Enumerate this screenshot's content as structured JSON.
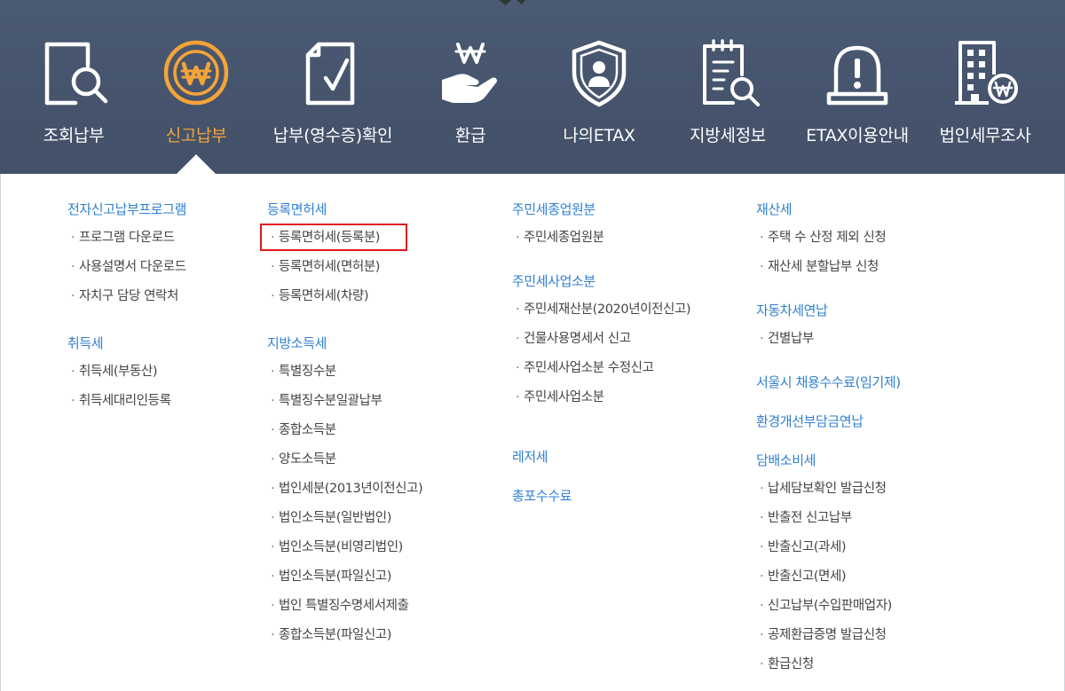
{
  "nav": [
    {
      "label": "조회납부",
      "icon": "search-document-icon"
    },
    {
      "label": "신고납부",
      "icon": "won-coin-icon",
      "active": true
    },
    {
      "label": "납부(영수증)확인",
      "icon": "document-check-icon"
    },
    {
      "label": "환급",
      "icon": "won-hand-icon"
    },
    {
      "label": "나의ETAX",
      "icon": "user-shield-icon"
    },
    {
      "label": "지방세정보",
      "icon": "notepad-search-icon"
    },
    {
      "label": "ETAX이용안내",
      "icon": "alert-bell-icon"
    },
    {
      "label": "법인세무조사",
      "icon": "building-won-icon"
    }
  ],
  "menu": {
    "col1": [
      {
        "title": "전자신고납부프로그램",
        "items": [
          "프로그램 다운로드",
          "사용설명서 다운로드",
          "자치구 담당 연락처"
        ]
      },
      {
        "title": "취득세",
        "items": [
          "취득세(부동산)",
          "취득세대리인등록"
        ]
      }
    ],
    "col2": [
      {
        "title": "등록면허세",
        "items": [
          "등록면허세(등록분)",
          "등록면허세(면허분)",
          "등록면허세(차량)"
        ]
      },
      {
        "title": "지방소득세",
        "items": [
          "특별징수분",
          "특별징수분일괄납부",
          "종합소득분",
          "양도소득분",
          "법인세분(2013년이전신고)",
          "법인소득분(일반법인)",
          "법인소득분(비영리법인)",
          "법인소득분(파일신고)",
          "법인 특별징수명세서제출",
          "종합소득분(파일신고)"
        ]
      }
    ],
    "col3": [
      {
        "title": "주민세종업원분",
        "items": [
          "주민세종업원분"
        ]
      },
      {
        "title": "주민세사업소분",
        "items": [
          "주민세재산분(2020년이전신고)",
          "건물사용명세서 신고",
          "주민세사업소분 수정신고",
          "주민세사업소분"
        ]
      },
      {
        "title": "레저세",
        "items": []
      },
      {
        "title": "총포수수료",
        "items": []
      }
    ],
    "col4": [
      {
        "title": "재산세",
        "items": [
          "주택 수 산정 제외 신청",
          "재산세 분할납부 신청"
        ]
      },
      {
        "title": "자동차세연납",
        "items": [
          "건별납부"
        ]
      },
      {
        "title": "서울시 채용수수료(임기제)",
        "items": []
      },
      {
        "title": "환경개선부담금연납",
        "items": []
      },
      {
        "title": "담배소비세",
        "items": [
          "납세담보확인 발급신청",
          "반출전 신고납부",
          "반출신고(과세)",
          "반출신고(면세)",
          "신고납부(수입판매업자)",
          "공제환급증명 발급신청",
          "환급신청"
        ]
      }
    ]
  },
  "colors": {
    "nav_bg": "#455570",
    "active": "#f5a438",
    "group_title": "#2f7fd0",
    "highlight": "#e0181f"
  }
}
